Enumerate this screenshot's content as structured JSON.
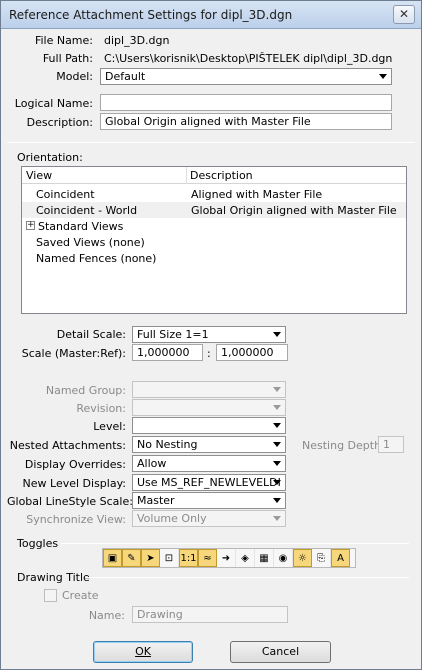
{
  "window": {
    "title": "Reference Attachment Settings for dipl_3D.dgn",
    "close_glyph": "✕"
  },
  "file": {
    "file_name_label": "File Name:",
    "file_name_value": "dipl_3D.dgn",
    "full_path_label": "Full Path:",
    "full_path_value": "C:\\Users\\korisnik\\Desktop\\PIŠTELEK dipl\\dipl_3D.dgn",
    "model_label": "Model:",
    "model_value": "Default",
    "logical_name_label": "Logical Name:",
    "logical_name_value": "",
    "description_label": "Description:",
    "description_value": "Global Origin aligned with Master File"
  },
  "orientation": {
    "label": "Orientation:",
    "col_view": "View",
    "col_description": "Description",
    "rows": [
      {
        "view": "Coincident",
        "description": "Aligned with Master File"
      },
      {
        "view": "Coincident - World",
        "description": "Global Origin aligned with Master File"
      },
      {
        "view": "Standard Views",
        "description": ""
      },
      {
        "view": "Saved Views (none)",
        "description": ""
      },
      {
        "view": "Named Fences (none)",
        "description": ""
      }
    ],
    "expander_glyph": "+"
  },
  "scale": {
    "detail_scale_label": "Detail Scale:",
    "detail_scale_value": "Full Size 1=1",
    "scale_label": "Scale (Master:Ref):",
    "master_value": "1,000000",
    "ref_value": "1,000000",
    "separator": ":"
  },
  "settings": {
    "named_group_label": "Named Group:",
    "named_group_value": "",
    "revision_label": "Revision:",
    "revision_value": "",
    "level_label": "Level:",
    "level_value": "",
    "nested_label": "Nested Attachments:",
    "nested_value": "No Nesting",
    "nesting_depth_label": "Nesting Depth:",
    "nesting_depth_value": "1",
    "display_overrides_label": "Display Overrides:",
    "display_overrides_value": "Allow",
    "new_level_label": "New Level Display:",
    "new_level_value": "Use MS_REF_NEWLEVELDI",
    "linestyle_label": "Global LineStyle Scale:",
    "linestyle_value": "Master",
    "sync_view_label": "Synchronize View:",
    "sync_view_value": "Volume Only"
  },
  "toggles": {
    "label": "Toggles",
    "items": [
      {
        "name": "display-toggle",
        "glyph": "▣",
        "on": true
      },
      {
        "name": "snap-toggle",
        "glyph": "✎",
        "on": true
      },
      {
        "name": "locate-toggle",
        "glyph": "➤",
        "on": true
      },
      {
        "name": "treat-as-element-toggle",
        "glyph": "⊡",
        "on": false
      },
      {
        "name": "true-scale-toggle",
        "glyph": "1:1",
        "on": true
      },
      {
        "name": "scale-line-styles-toggle",
        "glyph": "≈",
        "on": true
      },
      {
        "name": "ignore-attachment-toggle",
        "glyph": "➜",
        "on": false
      },
      {
        "name": "use-lights-toggle",
        "glyph": "◈",
        "on": false
      },
      {
        "name": "clip-toggle",
        "glyph": "▦",
        "on": false
      },
      {
        "name": "display-raster-toggle",
        "glyph": "◉",
        "on": false
      },
      {
        "name": "lights-toggle",
        "glyph": "☼",
        "on": true
      },
      {
        "name": "annotation-toggle",
        "glyph": "⎘",
        "on": false
      },
      {
        "name": "text-style-toggle",
        "glyph": "A",
        "on": true
      }
    ]
  },
  "drawing_title": {
    "label": "Drawing Title",
    "create_label": "Create",
    "name_label": "Name:",
    "name_placeholder": "Drawing"
  },
  "buttons": {
    "ok": "OK",
    "cancel": "Cancel"
  }
}
